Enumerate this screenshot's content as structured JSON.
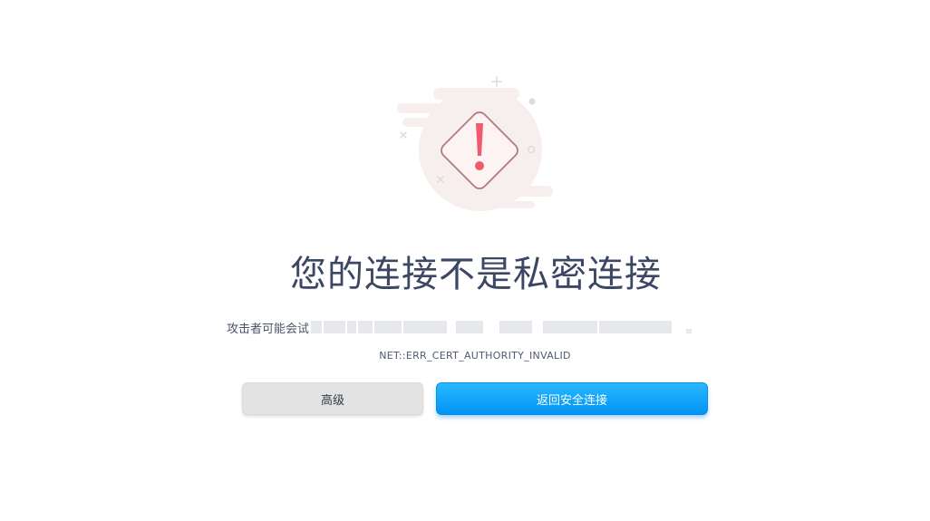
{
  "page": {
    "title": "您的连接不是私密连接",
    "description_prefix": "攻击者可能会试",
    "error_code": "NET::ERR_CERT_AUTHORITY_INVALID"
  },
  "buttons": {
    "advanced_label": "高级",
    "back_label": "返回安全连接"
  },
  "illustration": {
    "icon": "warning-diamond-icon",
    "accent_color": "#f05a6e",
    "background_color": "#f7eeee"
  },
  "colors": {
    "title": "#3b4763",
    "primary_button": "#0a9ef8",
    "secondary_button": "#e3e3e3"
  }
}
